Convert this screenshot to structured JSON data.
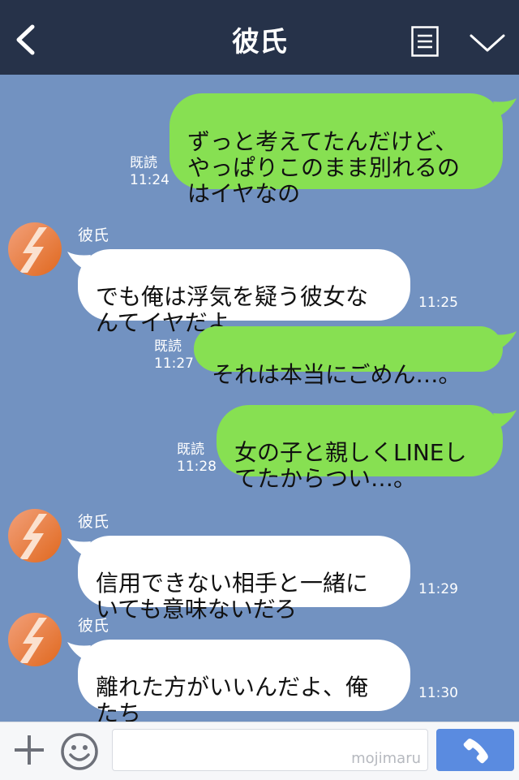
{
  "header": {
    "title": "彼氏"
  },
  "messages": [
    {
      "side": "me",
      "text": "ずっと考えてたんだけど、\nやっぱりこのまま別れるの\nはイヤなの",
      "read": "既読",
      "time": "11:24"
    },
    {
      "side": "them",
      "sender": "彼氏",
      "text": "でも俺は浮気を疑う彼女な\nんてイヤだよ",
      "time": "11:25"
    },
    {
      "side": "me",
      "text": "それは本当にごめん…。",
      "read": "既読",
      "time": "11:27"
    },
    {
      "side": "me",
      "text": "女の子と親しくLINEし\nてたからつい…。",
      "read": "既読",
      "time": "11:28"
    },
    {
      "side": "them",
      "sender": "彼氏",
      "text": "信用できない相手と一緒に\nいても意味ないだろ",
      "time": "11:29"
    },
    {
      "side": "them",
      "sender": "彼氏",
      "text": "離れた方がいいんだよ、俺\nたち",
      "time": "11:30"
    }
  ],
  "input": {
    "watermark": "mojimaru"
  },
  "colors": {
    "header": "#263249",
    "background": "#7292c1",
    "my_bubble": "#87e052",
    "their_bubble": "#ffffff",
    "send": "#5a8be0"
  },
  "icons": [
    "back-icon",
    "menu-icon",
    "chevron-down-icon",
    "plus-icon",
    "emoji-icon",
    "phone-icon"
  ]
}
